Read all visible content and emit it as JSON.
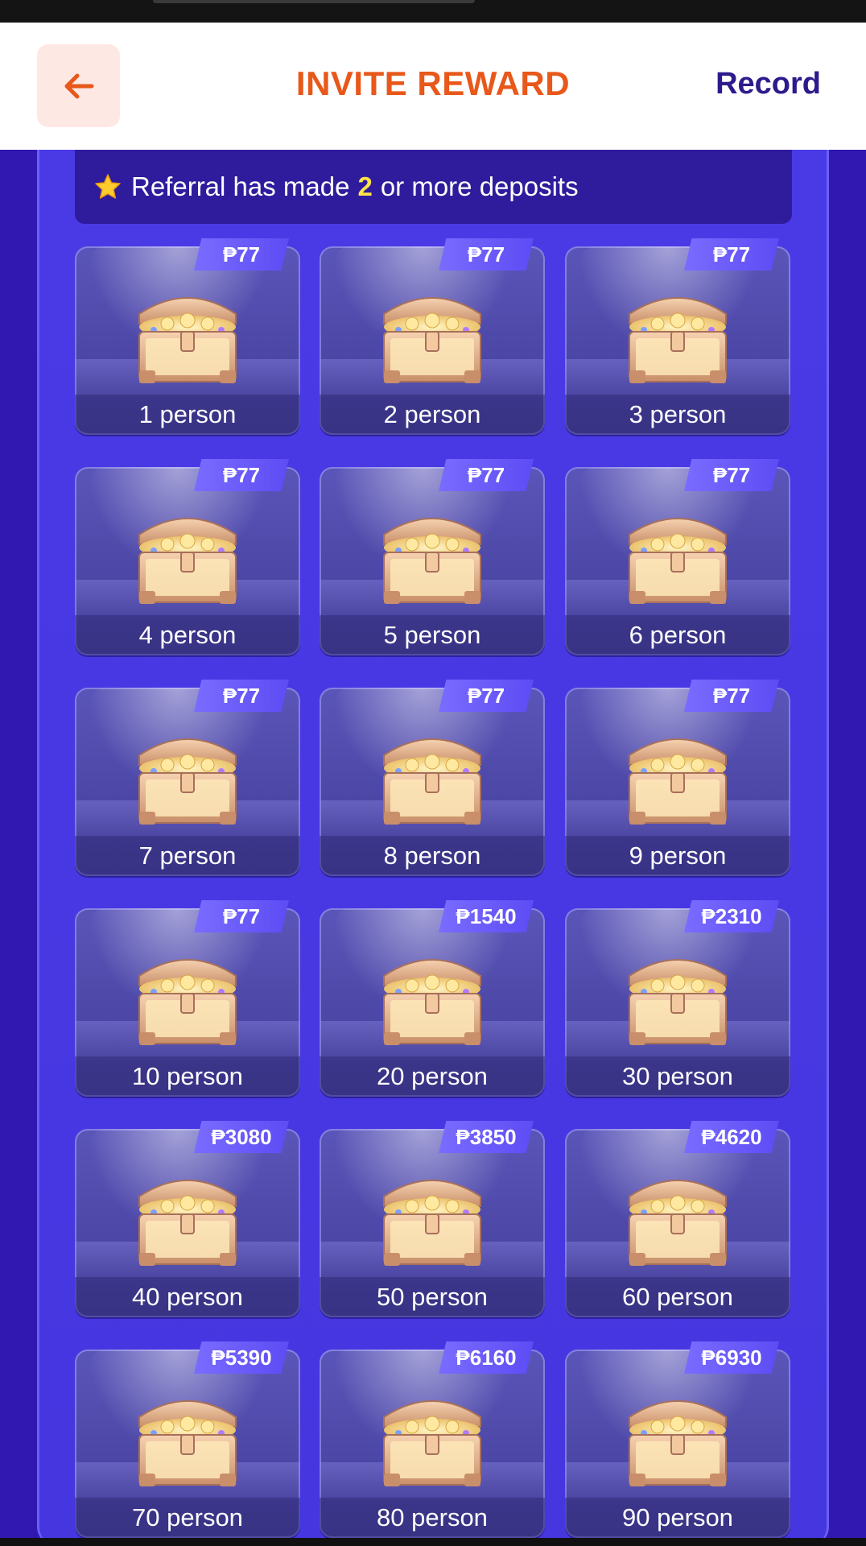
{
  "header": {
    "title": "INVITE REWARD",
    "record_label": "Record"
  },
  "condition": {
    "text_before": "Referral has made",
    "number": "2",
    "text_after": "or more deposits"
  },
  "colors": {
    "accent": "#e8581a",
    "record": "#2d1a8c",
    "panel": "#4536e0",
    "badge": "#6a5cff"
  },
  "rewards": [
    {
      "amount": "₱77",
      "label": "1 person"
    },
    {
      "amount": "₱77",
      "label": "2 person"
    },
    {
      "amount": "₱77",
      "label": "3 person"
    },
    {
      "amount": "₱77",
      "label": "4 person"
    },
    {
      "amount": "₱77",
      "label": "5 person"
    },
    {
      "amount": "₱77",
      "label": "6 person"
    },
    {
      "amount": "₱77",
      "label": "7 person"
    },
    {
      "amount": "₱77",
      "label": "8 person"
    },
    {
      "amount": "₱77",
      "label": "9 person"
    },
    {
      "amount": "₱77",
      "label": "10 person"
    },
    {
      "amount": "₱1540",
      "label": "20 person"
    },
    {
      "amount": "₱2310",
      "label": "30 person"
    },
    {
      "amount": "₱3080",
      "label": "40 person"
    },
    {
      "amount": "₱3850",
      "label": "50 person"
    },
    {
      "amount": "₱4620",
      "label": "60 person"
    },
    {
      "amount": "₱5390",
      "label": "70 person"
    },
    {
      "amount": "₱6160",
      "label": "80 person"
    },
    {
      "amount": "₱6930",
      "label": "90 person"
    }
  ]
}
